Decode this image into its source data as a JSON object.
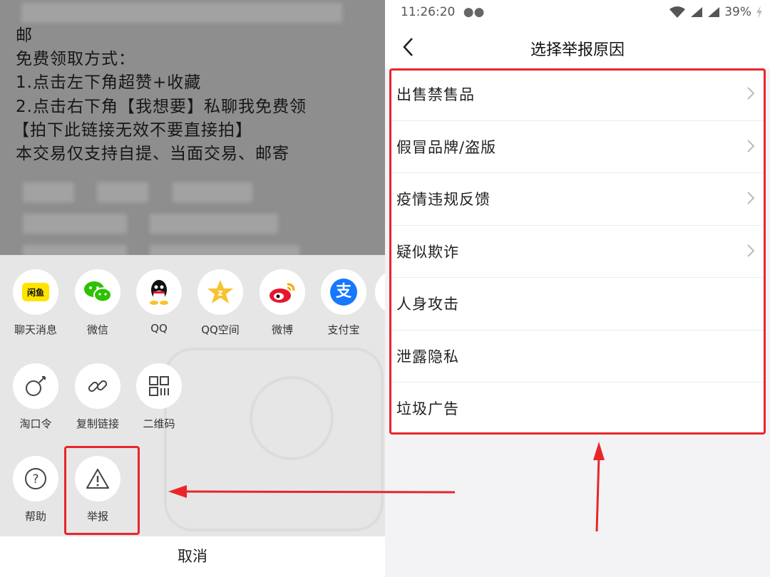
{
  "left_panel": {
    "description": {
      "lines": [
        "邮",
        "免费领取方式：",
        "1.点击左下角超赞+收藏",
        "2.点击右下角【我想要】私聊我免费领",
        "【拍下此链接无效不要直接拍】",
        "本交易仅支持自提、当面交易、邮寄"
      ]
    },
    "share_row1": [
      {
        "label": "聊天消息",
        "icon": "xianyu-icon"
      },
      {
        "label": "微信",
        "icon": "wechat-icon"
      },
      {
        "label": "QQ",
        "icon": "qq-icon"
      },
      {
        "label": "QQ空间",
        "icon": "qzone-icon"
      },
      {
        "label": "微博",
        "icon": "weibo-icon"
      },
      {
        "label": "支付宝",
        "icon": "alipay-icon"
      }
    ],
    "share_row2": [
      {
        "label": "淘口令",
        "icon": "taokouling-icon"
      },
      {
        "label": "复制链接",
        "icon": "link-icon"
      },
      {
        "label": "二维码",
        "icon": "qrcode-icon"
      }
    ],
    "share_row3": [
      {
        "label": "帮助",
        "icon": "help-icon"
      },
      {
        "label": "举报",
        "icon": "report-icon"
      }
    ],
    "xianyu_logo_text": "闲鱼",
    "cancel_label": "取消"
  },
  "right_panel": {
    "status_bar": {
      "time": "11:26:20",
      "battery": "39%"
    },
    "nav": {
      "title": "选择举报原因"
    },
    "reasons": [
      {
        "label": "出售禁售品",
        "has_chevron": true
      },
      {
        "label": "假冒品牌/盗版",
        "has_chevron": true
      },
      {
        "label": "疫情违规反馈",
        "has_chevron": true
      },
      {
        "label": "疑似欺诈",
        "has_chevron": true
      },
      {
        "label": "人身攻击",
        "has_chevron": false
      },
      {
        "label": "泄露隐私",
        "has_chevron": false
      },
      {
        "label": "垃圾广告",
        "has_chevron": false
      }
    ]
  },
  "colors": {
    "highlight": "#e8262a",
    "xianyu_yellow": "#ffe400",
    "wechat_green": "#2dc100",
    "qzone_yellow": "#f7c32e",
    "weibo_red": "#e6162d",
    "alipay_blue": "#1677ff"
  }
}
